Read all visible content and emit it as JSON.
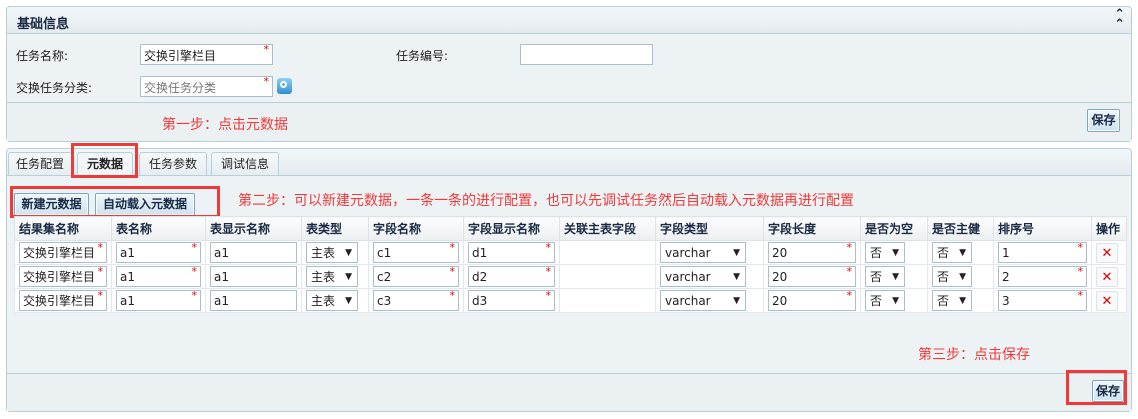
{
  "basic": {
    "title": "基础信息",
    "collapse_icon": "double-chevron-up-icon",
    "task_name_label": "任务名称:",
    "task_name_value": "交换引擎栏目",
    "task_code_label": "任务编号:",
    "task_code_value": "",
    "category_label": "交换任务分类:",
    "category_placeholder": "交换任务分类",
    "required_mark": "*",
    "save": "保存",
    "step1": "第一步：点击元数据"
  },
  "tabs": [
    {
      "label": "任务配置"
    },
    {
      "label": "元数据",
      "active": true
    },
    {
      "label": "任务参数"
    },
    {
      "label": "调试信息"
    }
  ],
  "meta": {
    "new_btn": "新建元数据",
    "auto_btn": "自动载入元数据",
    "step2": "第二步：可以新建元数据，一条一条的进行配置，也可以先调试任务然后自动载入元数据再进行配置",
    "step3": "第三步：点击保存",
    "save": "保存",
    "columns": [
      "结果集名称",
      "表名称",
      "表显示名称",
      "表类型",
      "字段名称",
      "字段显示名称",
      "关联主表字段",
      "字段类型",
      "字段长度",
      "是否为空",
      "是否主健",
      "排序号",
      "操作"
    ],
    "rows": [
      {
        "result_set": "交换引擎栏目",
        "table": "a1",
        "table_display": "a1",
        "table_type": "主表",
        "field": "c1",
        "field_display": "d1",
        "rel": "",
        "field_type": "varchar",
        "length": "20",
        "nullable": "否",
        "pk": "否",
        "order": "1",
        "delete": "✕"
      },
      {
        "result_set": "交换引擎栏目",
        "table": "a1",
        "table_display": "a1",
        "table_type": "主表",
        "field": "c2",
        "field_display": "d2",
        "rel": "",
        "field_type": "varchar",
        "length": "20",
        "nullable": "否",
        "pk": "否",
        "order": "2",
        "delete": "✕"
      },
      {
        "result_set": "交换引擎栏目",
        "table": "a1",
        "table_display": "a1",
        "table_type": "主表",
        "field": "c3",
        "field_display": "d3",
        "rel": "",
        "field_type": "varchar",
        "length": "20",
        "nullable": "否",
        "pk": "否",
        "order": "3",
        "delete": "✕"
      }
    ]
  },
  "colors": {
    "annotation": "#f03a3a",
    "border": "#b9cfd8",
    "panel_bg": "#edf2f5"
  }
}
